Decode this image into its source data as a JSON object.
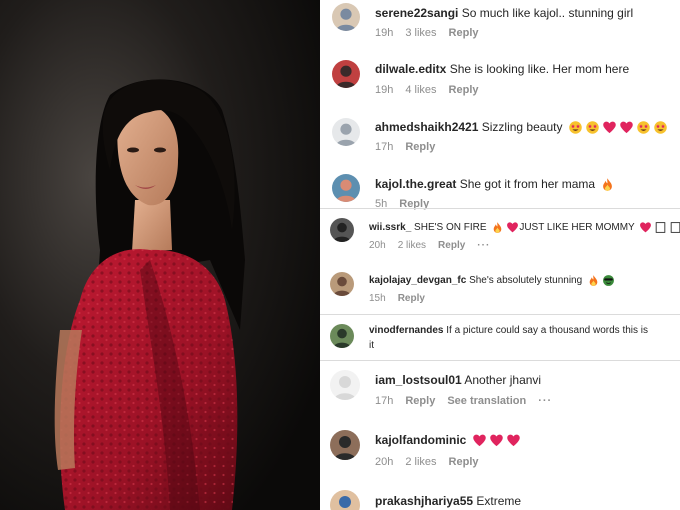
{
  "comments": [
    {
      "user": "serene22sangi",
      "text": "So much like kajol.. stunning girl",
      "time": "19h",
      "likes": "3 likes",
      "reply": "Reply"
    },
    {
      "user": "dilwale.editx",
      "text": "She is looking like. Her mom here",
      "time": "19h",
      "likes": "4 likes",
      "reply": "Reply"
    },
    {
      "user": "ahmedshaikh2421",
      "text": "Sizzling beauty",
      "emoji": [
        "star-struck",
        "star-struck",
        "red-heart",
        "red-heart",
        "star-struck",
        "star-struck"
      ],
      "time": "17h",
      "reply": "Reply"
    },
    {
      "user": "kajol.the.great",
      "text": "She got it from her mama",
      "emoji": [
        "fire"
      ],
      "time": "5h",
      "reply": "Reply"
    },
    {
      "user": "wii.ssrk_",
      "text": "SHE'S ON FIRE",
      "emoji_mid": [
        "fire",
        "red-heart"
      ],
      "text2": "JUST LIKE HER MOMMY",
      "emoji_end": [
        "red-heart",
        "box",
        "box"
      ],
      "time": "20h",
      "likes": "2 likes",
      "reply": "Reply",
      "more": "···"
    },
    {
      "user": "kajolajay_devgan_fc",
      "text": "She's absolutely stunning",
      "emoji": [
        "fire",
        "smiling-face-with-sunglasses"
      ],
      "time": "15h",
      "reply": "Reply"
    },
    {
      "user": "vinodfernandes",
      "text": "If a picture could say a thousand words this is",
      "text_cont": "it"
    },
    {
      "user": "iam_lostsoul01",
      "text": "Another jhanvi",
      "time": "17h",
      "reply": "Reply",
      "translate": "See translation",
      "more": "···"
    },
    {
      "user": "kajolfandominic",
      "emoji": [
        "red-heart",
        "red-heart",
        "red-heart"
      ],
      "time": "20h",
      "likes": "2 likes",
      "reply": "Reply"
    },
    {
      "user": "prakashjhariya55",
      "text": "Extreme"
    }
  ],
  "colors": {
    "heart": "#e0245e",
    "fire": "#f4731c",
    "star_face": "#f7c22d",
    "photo_bg": "#1e1c1a",
    "dress": "#a8142a",
    "meta": "#8e8e8e"
  }
}
